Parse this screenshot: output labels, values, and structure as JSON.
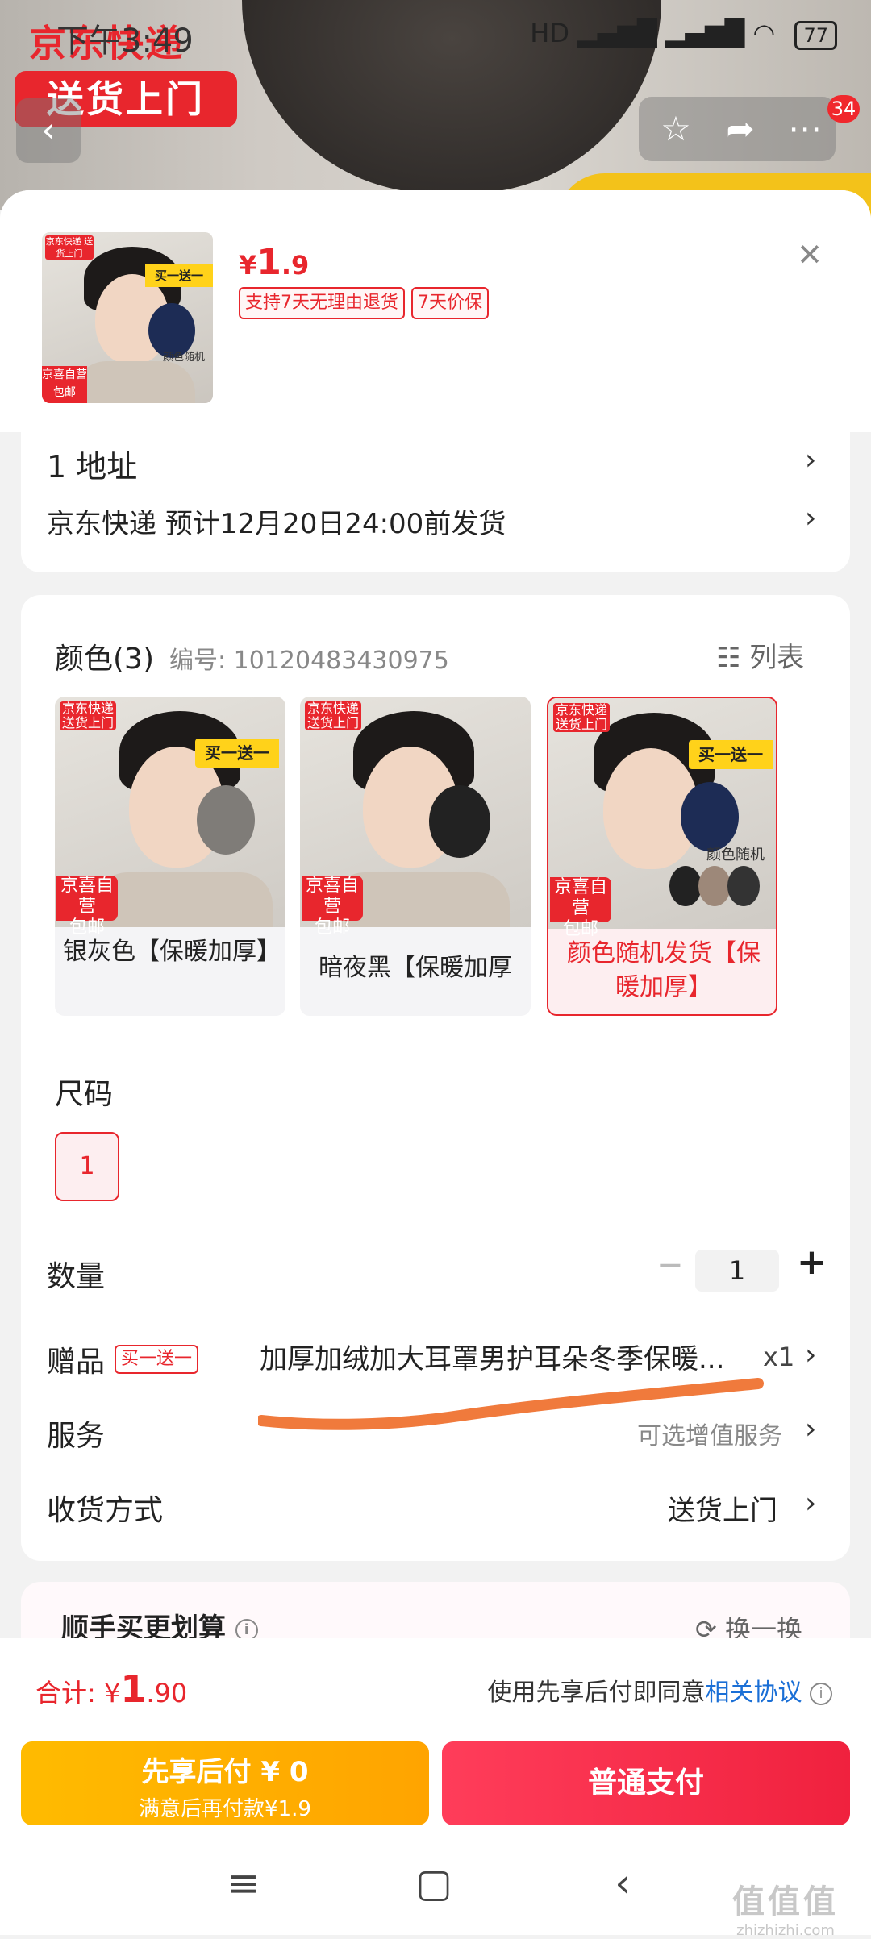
{
  "status_bar": {
    "time": "下午3:49",
    "network": "HD ",
    "battery": "77"
  },
  "background": {
    "jd_word": "京东快递",
    "jd_badge": "送货上门",
    "share_count": "34"
  },
  "product": {
    "price_currency": "¥",
    "price_int": "1",
    "price_dec": ".9",
    "tags": [
      "支持7天无理由退货",
      "7天价保"
    ],
    "thumb": {
      "jd_label": "京东快递 送货上门",
      "bogo": "买一送一",
      "random": "颜色随机",
      "by_label": "京喜自营",
      "free_ship": "包邮"
    }
  },
  "address": {
    "label": "1 地址",
    "shipping": "京东快递 预计12月20日24:00前发货"
  },
  "color": {
    "title": "颜色(3)",
    "code": "编号: 10120483430975",
    "list_label": "列表",
    "options": [
      {
        "label": "银灰色【保暖加厚】",
        "selected": false,
        "jd_label": "京东快递 送货上门",
        "by_label": "京喜自营",
        "free_ship": "包邮",
        "bogo": "买一送一",
        "muff_color": "#7f7c78"
      },
      {
        "label": "暗夜黑【保暖加厚",
        "selected": false,
        "jd_label": "京东快递 送货上门",
        "by_label": "京喜自营",
        "free_ship": "包邮",
        "bogo": "",
        "muff_color": "#222222"
      },
      {
        "label": "颜色随机发货【保暖加厚】",
        "selected": true,
        "jd_label": "京东快递 送货上门",
        "by_label": "京喜自营",
        "free_ship": "包邮",
        "bogo": "买一送一",
        "random": "颜色随机",
        "muff_color": "#1d2c55"
      }
    ]
  },
  "size": {
    "title": "尺码",
    "options": [
      "1"
    ]
  },
  "quantity": {
    "label": "数量",
    "value": "1",
    "minus": "−",
    "plus": "+"
  },
  "gift": {
    "label": "赠品",
    "tag": "买一送一",
    "desc": "加厚加绒加大耳罩男护耳朵冬季保暖...",
    "count": "x1"
  },
  "service": {
    "label": "服务",
    "value": "可选增值服务"
  },
  "delivery": {
    "label": "收货方式",
    "value": "送货上门"
  },
  "promo": {
    "title": "顺手买更划算",
    "refresh": "换一换"
  },
  "footer": {
    "total_label": "合计: ",
    "total_currency": "¥",
    "total_int": "1",
    "total_dec": ".90",
    "agree_text": "使用先享后付即同意",
    "agree_link": "相关协议",
    "pay_later_title": "先享后付 ¥ 0",
    "pay_later_sub": "满意后再付款¥1.9",
    "pay_normal": "普通支付"
  },
  "watermark": {
    "brand": "值值值",
    "site": "zhizhizhi.com"
  },
  "colors": {
    "accent": "#e8262d",
    "yellow": "#ffb000",
    "pay_red": "#f0213e",
    "link": "#1a6fd6",
    "annotation_stroke": "#f07a3c"
  }
}
